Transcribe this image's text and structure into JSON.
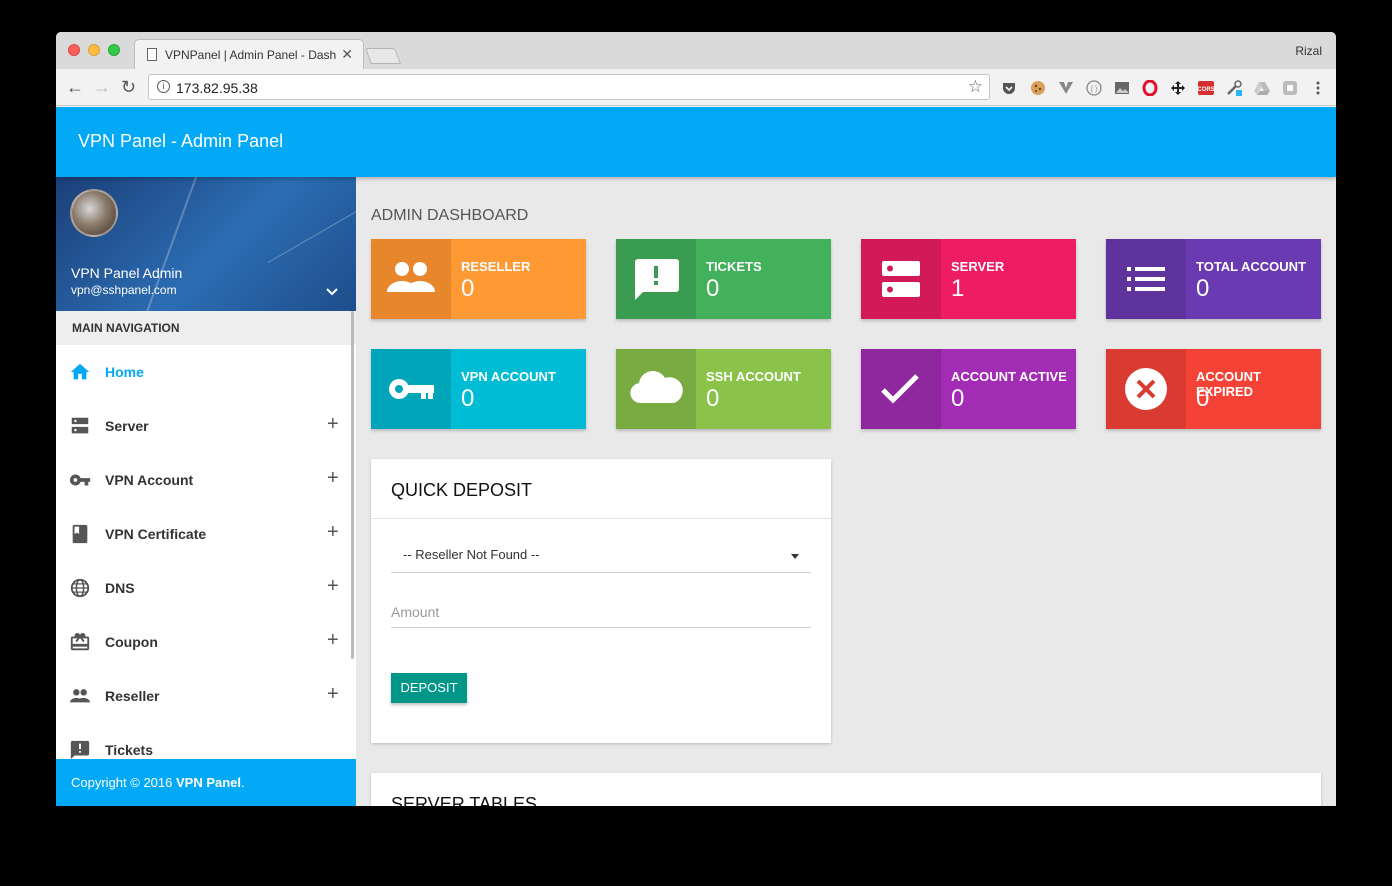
{
  "browser": {
    "tab_title": "VPNPanel | Admin Panel - Dash",
    "tab_close": "✕",
    "profile_name": "Rizal",
    "url": "173.82.95.38",
    "nav_back": "←",
    "nav_forward": "→",
    "nav_reload": "↻",
    "bookmark_star": "☆",
    "info": "i",
    "extensions": [
      "pocket-icon",
      "cookie-icon",
      "vimium-icon",
      "json-icon",
      "image-icon",
      "opera-icon",
      "move-icon",
      "cors-icon",
      "tool-icon",
      "drive-icon",
      "box-icon",
      "menu-icon"
    ]
  },
  "app": {
    "brand": "VPN Panel - Admin Panel",
    "accent_color": "#03a9f4"
  },
  "user": {
    "name": "VPN Panel Admin",
    "email": "vpn@sshpanel.com",
    "chevron": "⌄"
  },
  "sidebar": {
    "header": "MAIN NAVIGATION",
    "items": [
      {
        "label": "Home",
        "icon": "home-icon",
        "active": true
      },
      {
        "label": "Server",
        "icon": "server-icon",
        "expand": "+"
      },
      {
        "label": "VPN Account",
        "icon": "key-icon",
        "expand": "+"
      },
      {
        "label": "VPN Certificate",
        "icon": "book-icon",
        "expand": "+"
      },
      {
        "label": "DNS",
        "icon": "globe-icon",
        "expand": "+"
      },
      {
        "label": "Coupon",
        "icon": "gift-card-icon",
        "expand": "+"
      },
      {
        "label": "Reseller",
        "icon": "people-icon",
        "expand": "+"
      },
      {
        "label": "Tickets",
        "icon": "feedback-icon"
      }
    ],
    "footer_prefix": "Copyright © 2016 ",
    "footer_brand": "VPN Panel",
    "footer_suffix": "."
  },
  "dashboard": {
    "title": "ADMIN DASHBOARD",
    "stats": [
      {
        "label": "RESELLER",
        "value": "0",
        "icon": "people-icon",
        "color": "#ff9933",
        "icon_bg": "#e8862c"
      },
      {
        "label": "TICKETS",
        "value": "0",
        "icon": "feedback-icon",
        "color": "#43b05c",
        "icon_bg": "#3a9c50"
      },
      {
        "label": "SERVER",
        "value": "1",
        "icon": "server-icon",
        "color": "#ee1d63",
        "icon_bg": "#d31a58"
      },
      {
        "label": "TOTAL ACCOUNT",
        "value": "0",
        "icon": "list-icon",
        "color": "#6a3ab2",
        "icon_bg": "#5e339e"
      },
      {
        "label": "VPN ACCOUNT",
        "value": "0",
        "icon": "key-icon",
        "color": "#00bcd4",
        "icon_bg": "#00a5ba"
      },
      {
        "label": "SSH ACCOUNT",
        "value": "0",
        "icon": "cloud-icon",
        "color": "#8bc34a",
        "icon_bg": "#7aab42"
      },
      {
        "label": "ACCOUNT ACTIVE",
        "value": "0",
        "icon": "check-icon",
        "color": "#a22cb4",
        "icon_bg": "#8f279e"
      },
      {
        "label": "ACCOUNT EXPIRED",
        "value": "0",
        "icon": "cancel-icon",
        "color": "#f44336",
        "icon_bg": "#d93b30"
      }
    ]
  },
  "deposit": {
    "title": "QUICK DEPOSIT",
    "select_value": "-- Reseller Not Found --",
    "amount_placeholder": "Amount",
    "button": "DEPOSIT"
  },
  "server_tables": {
    "title": "SERVER TABLES"
  }
}
